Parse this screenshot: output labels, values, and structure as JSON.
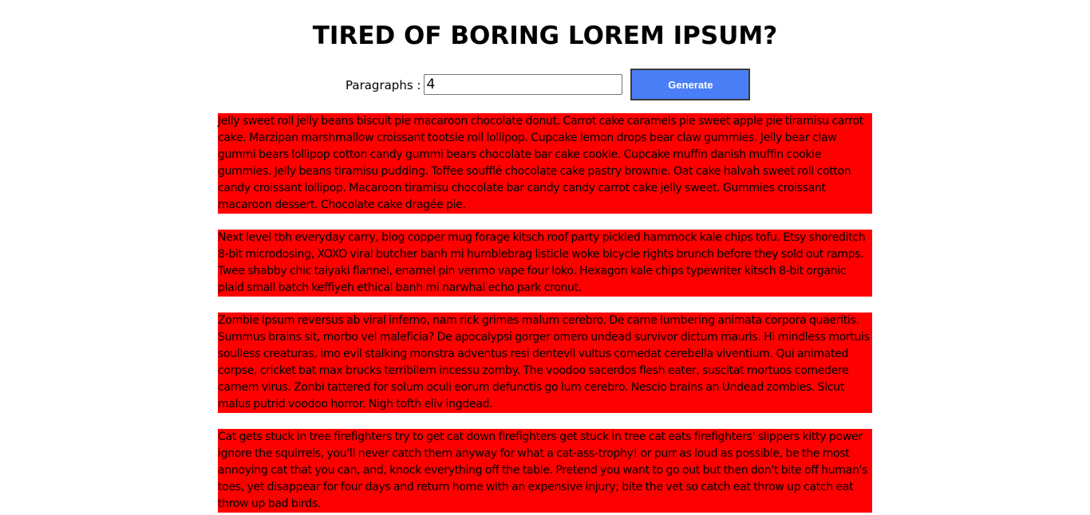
{
  "header": {
    "title": "TIRED OF BORING LOREM IPSUM?"
  },
  "form": {
    "paragraphs_label": "Paragraphs :",
    "paragraphs_value": "4",
    "generate_label": "Generate"
  },
  "colors": {
    "paragraph_background": "#ff0000",
    "button_background": "#4a7ef7"
  },
  "paragraphs": [
    "Jelly sweet roll jelly beans biscuit pie macaroon chocolate donut. Carrot cake caramels pie sweet apple pie tiramisu carrot cake. Marzipan marshmallow croissant tootsie roll lollipop. Cupcake lemon drops bear claw gummies. Jelly bear claw gummi bears lollipop cotton candy gummi bears chocolate bar cake cookie. Cupcake muffin danish muffin cookie gummies. Jelly beans tiramisu pudding. Toffee soufflé chocolate cake pastry brownie. Oat cake halvah sweet roll cotton candy croissant lollipop. Macaroon tiramisu chocolate bar candy candy carrot cake jelly sweet. Gummies croissant macaroon dessert. Chocolate cake dragée pie.",
    "Next level tbh everyday carry, blog copper mug forage kitsch roof party pickled hammock kale chips tofu. Etsy shoreditch 8-bit microdosing, XOXO viral butcher banh mi humblebrag listicle woke bicycle rights brunch before they sold out ramps. Twee shabby chic taiyaki flannel, enamel pin venmo vape four loko. Hexagon kale chips typewriter kitsch 8-bit organic plaid small batch keffiyeh ethical banh mi narwhal echo park cronut.",
    "Zombie ipsum reversus ab viral inferno, nam rick grimes malum cerebro. De carne lumbering animata corpora quaeritis. Summus brains sit, morbo vel maleficia? De apocalypsi gorger omero undead survivor dictum mauris. Hi mindless mortuis soulless creaturas, imo evil stalking monstra adventus resi dentevil vultus comedat cerebella viventium. Qui animated corpse, cricket bat max brucks terribilem incessu zomby. The voodoo sacerdos flesh eater, suscitat mortuos comedere carnem virus. Zonbi tattered for solum oculi eorum defunctis go lum cerebro. Nescio brains an Undead zombies. Sicut malus putrid voodoo horror. Nigh tofth eliv ingdead.",
    "Cat gets stuck in tree firefighters try to get cat down firefighters get stuck in tree cat eats firefighters' slippers kitty power ignore the squirrels, you'll never catch them anyway for what a cat-ass-trophy! or purr as loud as possible, be the most annoying cat that you can, and, knock everything off the table. Pretend you want to go out but then don't bite off human's toes, yet disappear for four days and return home with an expensive injury; bite the vet so catch eat throw up catch eat throw up bad birds."
  ]
}
